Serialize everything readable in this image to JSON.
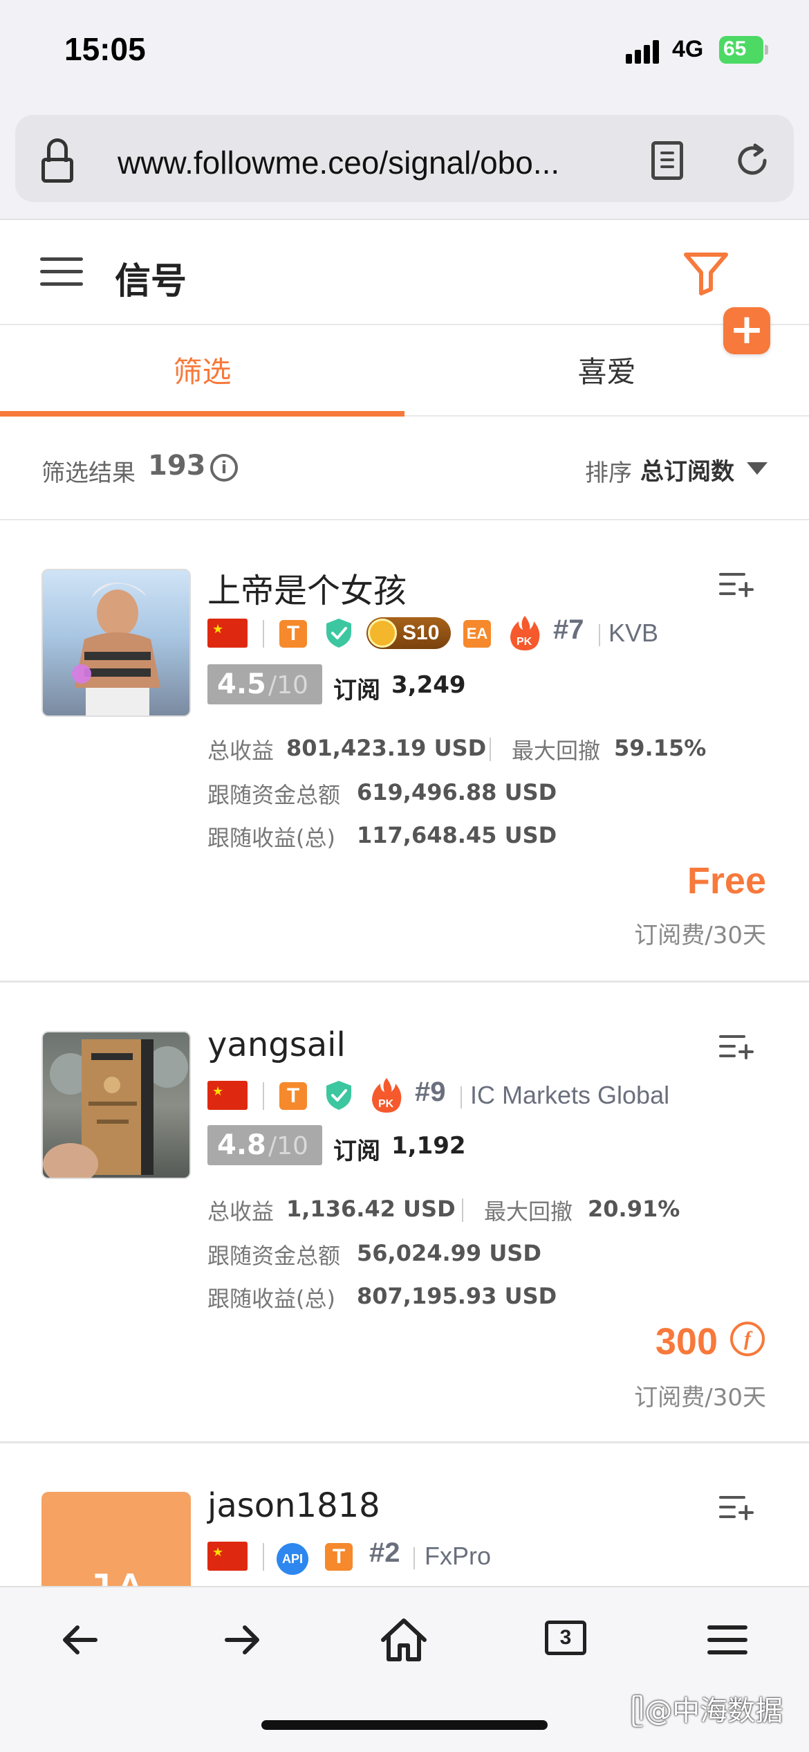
{
  "status_bar": {
    "time": "15:05",
    "network": "4G",
    "battery": "65"
  },
  "browser": {
    "url": "www.followme.ceo/signal/obo..."
  },
  "header": {
    "title": "信号"
  },
  "tabs": [
    {
      "label": "筛选",
      "active": true
    },
    {
      "label": "喜爱",
      "active": false
    }
  ],
  "results": {
    "label": "筛选结果",
    "count": "193",
    "sort_label": "排序",
    "sort_value": "总订阅数"
  },
  "accent_color": "#f7793b",
  "signals": [
    {
      "name": "上帝是个女孩",
      "tier": "S10",
      "has_ea": true,
      "rank": "#7",
      "broker": "KVB",
      "score": "4.5",
      "score_max": "/10",
      "subs_label": "订阅",
      "subs": "3,249",
      "total_profit_label": "总收益",
      "total_profit": "801,423.19 USD",
      "max_drawdown_label": "最大回撤",
      "max_drawdown": "59.15%",
      "follow_funds_label": "跟随资金总额",
      "follow_funds": "619,496.88 USD",
      "follow_profit_label": "跟随收益(总)",
      "follow_profit": "117,648.45 USD",
      "price": "Free",
      "price_note": "订阅费/30天"
    },
    {
      "name": "yangsail",
      "rank": "#9",
      "broker": "IC Markets Global",
      "score": "4.8",
      "score_max": "/10",
      "subs_label": "订阅",
      "subs": "1,192",
      "total_profit_label": "总收益",
      "total_profit": "1,136.42 USD",
      "max_drawdown_label": "最大回撤",
      "max_drawdown": "20.91%",
      "follow_funds_label": "跟随资金总额",
      "follow_funds": "56,024.99 USD",
      "follow_profit_label": "跟随收益(总)",
      "follow_profit": "807,195.93 USD",
      "price": "300",
      "price_note": "订阅费/30天"
    },
    {
      "name": "jason1818",
      "avatar_initials": "JA",
      "api_label": "API",
      "rank": "#2",
      "broker": "FxPro"
    }
  ],
  "toolbar": {
    "tabs_count": "3"
  },
  "watermark": "中海数据"
}
